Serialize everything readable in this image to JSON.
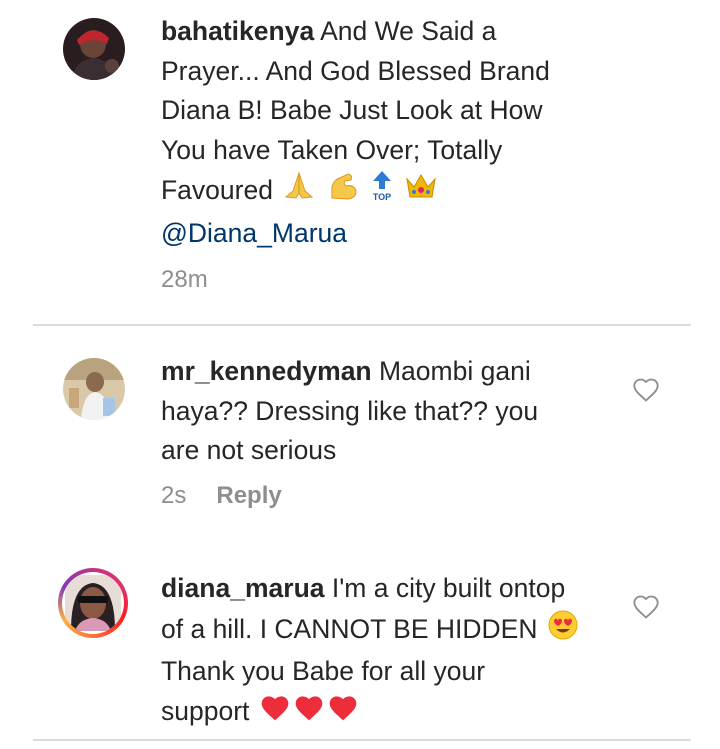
{
  "comments": [
    {
      "username": "bahatikenya",
      "text_line1": " And We Said a",
      "text_line2": "Prayer... And God Blessed Brand",
      "text_line3": "Diana B! Babe Just Look at How",
      "text_line4": "You have Taken Over; Totally",
      "text_line5": "Favoured",
      "emojis": [
        "folded-hands-icon",
        "flexed-biceps-icon",
        "top-arrow-icon",
        "crown-icon"
      ],
      "top_label": "TOP",
      "mention": "@Diana_Marua",
      "time": "28m"
    },
    {
      "username": "mr_kennedyman",
      "text_line1": " Maombi gani",
      "text_line2": "haya?? Dressing like that?? you",
      "text_line3": "are not serious",
      "time": "2s",
      "reply_label": "Reply"
    },
    {
      "username": "diana_marua",
      "text_line1": " I'm a city built ontop",
      "text_line2": "of a hill. I CANNOT BE HIDDEN",
      "text_line3": "Thank you Babe for all your",
      "text_line4": "support",
      "emojis": [
        "heart-eyes-icon",
        "red-heart-icon",
        "red-heart-icon",
        "red-heart-icon"
      ]
    }
  ],
  "colors": {
    "text": "#262626",
    "secondary": "#8e8e8e",
    "mention": "#00376b",
    "divider": "#dbdbdb",
    "heart_red": "#ed2e3a"
  }
}
